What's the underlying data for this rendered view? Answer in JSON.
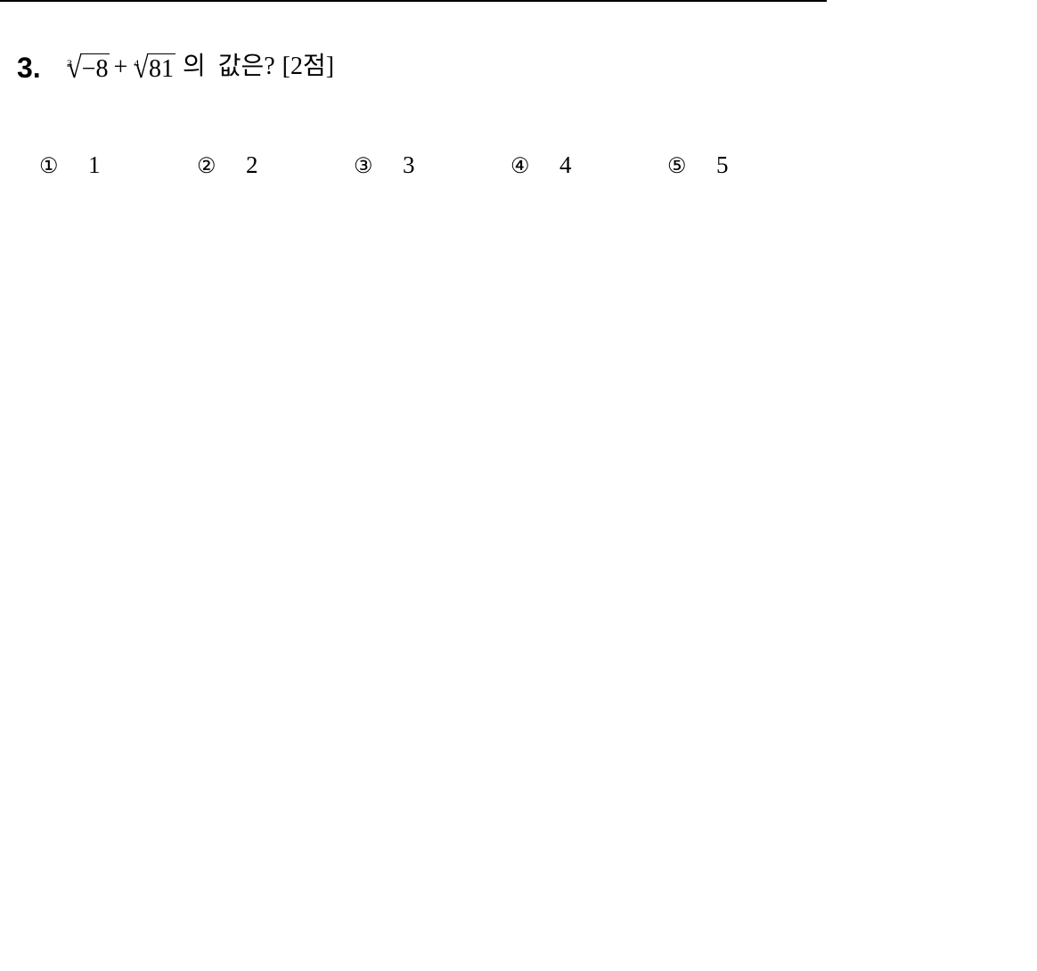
{
  "question": {
    "number": "3.",
    "radical1": {
      "index": "3",
      "radicand": "−8"
    },
    "operator": "+",
    "radical2": {
      "index": "4",
      "radicand": "81"
    },
    "text": "의  값은?",
    "points": "[2점]"
  },
  "choices": [
    {
      "mark": "①",
      "value": "1"
    },
    {
      "mark": "②",
      "value": "2"
    },
    {
      "mark": "③",
      "value": "3"
    },
    {
      "mark": "④",
      "value": "4"
    },
    {
      "mark": "⑤",
      "value": "5"
    }
  ]
}
